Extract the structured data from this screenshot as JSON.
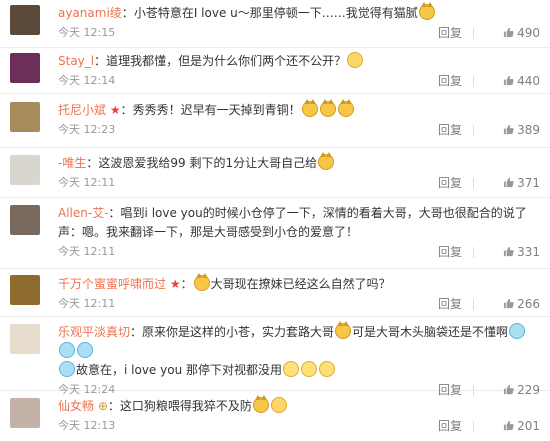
{
  "comments": [
    {
      "user": "ayanami绫",
      "text": "小苍特意在I love u～那里停顿一下……我觉得有猫腻",
      "emoji_after": [
        "cat"
      ],
      "time": "今天 12:15",
      "reply": "回复",
      "likes": "490",
      "avatar_color": "#5b4a3a"
    },
    {
      "user": "Stay_l",
      "text": "道理我都懂，但是为什么你们两个还不公开？",
      "emoji_after": [
        "blush"
      ],
      "time": "今天 12:14",
      "reply": "回复",
      "likes": "440",
      "avatar_color": "#6b2f5a"
    },
    {
      "user": "托尼小斌",
      "badge": "★",
      "text": "秀秀秀！迟早有一天掉到青铜！",
      "emoji_after": [
        "cat",
        "cat",
        "cat"
      ],
      "time": "今天 12:23",
      "reply": "回复",
      "likes": "389",
      "avatar_color": "#a88b5a"
    },
    {
      "user": "-唯生",
      "text": "这波恩爱我给99 剩下的1分让大哥自己给",
      "emoji_after": [
        "cat"
      ],
      "time": "今天 12:11",
      "reply": "回复",
      "likes": "371",
      "avatar_color": "#d8d6cf"
    },
    {
      "user": "Allen-艾-",
      "text": "唱到i love you的时候小仓停了一下，深情的看着大哥，大哥也很配合的说了声：嗯。我来翻译一下，那是大哥感受到小仓的爱意了！",
      "emoji_after": [],
      "time": "今天 12:11",
      "reply": "回复",
      "likes": "331",
      "avatar_color": "#7a6a5e"
    },
    {
      "user": "千万个蜜蜜呼啸而过",
      "badge": "★",
      "text": "大哥现在撩妹已经这么自然了吗？",
      "emoji_before": [
        "cat"
      ],
      "emoji_after": [],
      "time": "今天 12:11",
      "reply": "回复",
      "likes": "266",
      "avatar_color": "#8c6b2d"
    },
    {
      "user": "乐观平淡真切",
      "text_a": "原来你是这样的小苍，实力套路大哥",
      "text_b": "可是大哥木头脑袋还是不懂啊",
      "text_c": "故意在，i love you 那停下对视都没用",
      "emoji_mid": [
        "cat"
      ],
      "emoji_after_b": [
        "cry",
        "cry",
        "cry"
      ],
      "emoji_lead_c": [
        "cry"
      ],
      "emoji_after": [
        "flat",
        "flat",
        "flat"
      ],
      "time": "今天 12:24",
      "reply": "回复",
      "likes": "229",
      "avatar_color": "#e7dccc"
    },
    {
      "user": "仙女畅",
      "badge": "⊕",
      "text": "这口狗粮喂得我猝不及防",
      "emoji_after": [
        "cat",
        "blush"
      ],
      "time": "今天 12:13",
      "reply": "回复",
      "likes": "201",
      "avatar_color": "#c4b2a8"
    }
  ],
  "colors": {
    "username": "#eb7350",
    "meta": "#999999",
    "divider": "#ececec"
  },
  "icons": {
    "like": "thumb-up-icon"
  }
}
